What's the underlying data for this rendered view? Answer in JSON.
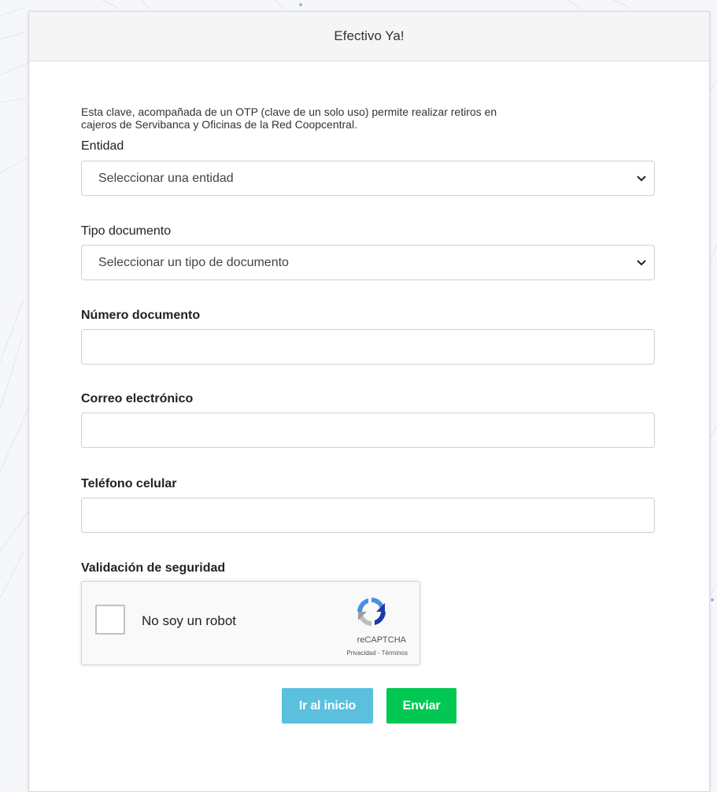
{
  "header": {
    "title": "Efectivo Ya!"
  },
  "intro": {
    "text_line1": "Esta clave, acompañada de un OTP (clave de un solo uso) permite realizar retiros en",
    "text_line2": "cajeros de Servibanca y Oficinas de la Red Coopcentral."
  },
  "form": {
    "entidad": {
      "label": "Entidad",
      "selected": "Seleccionar una entidad"
    },
    "tipo_documento": {
      "label": "Tipo documento",
      "selected": "Seleccionar un tipo de documento"
    },
    "numero_documento": {
      "label": "Número documento",
      "value": ""
    },
    "correo": {
      "label": "Correo electrónico",
      "value": ""
    },
    "telefono": {
      "label": "Teléfono celular",
      "value": ""
    },
    "validacion": {
      "label": "Validación de seguridad"
    }
  },
  "recaptcha": {
    "checkbox_label": "No soy un robot",
    "brand": "reCAPTCHA",
    "links": "Privacidad - Términos"
  },
  "buttons": {
    "home": "Ir al inicio",
    "send": "Enviar"
  },
  "colors": {
    "button_home": "#5bc0de",
    "button_send": "#00c853"
  }
}
